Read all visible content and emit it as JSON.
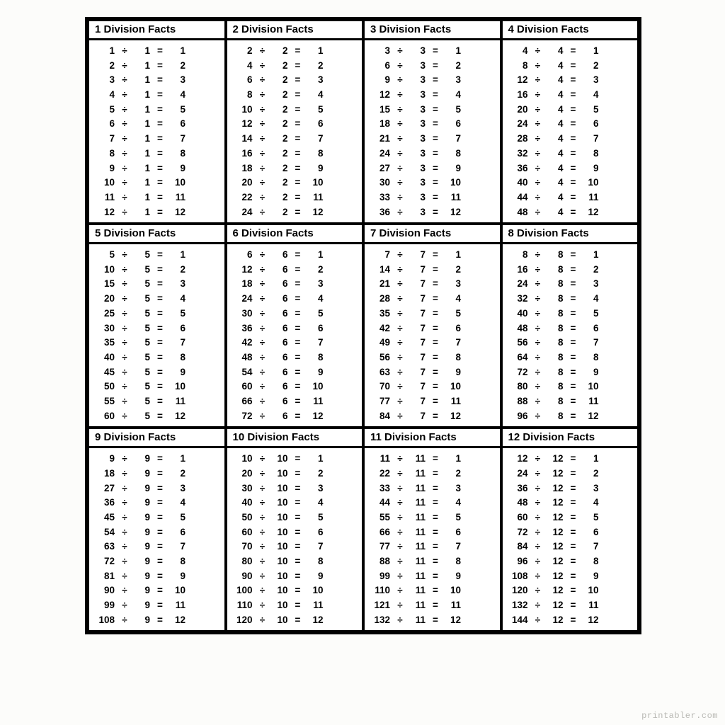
{
  "watermark": "printabler.com",
  "symbols": {
    "div": "÷",
    "eq": "="
  },
  "tables": [
    {
      "title": "1 Division Facts",
      "divisor": 1,
      "rows": [
        [
          1,
          1,
          1
        ],
        [
          2,
          1,
          2
        ],
        [
          3,
          1,
          3
        ],
        [
          4,
          1,
          4
        ],
        [
          5,
          1,
          5
        ],
        [
          6,
          1,
          6
        ],
        [
          7,
          1,
          7
        ],
        [
          8,
          1,
          8
        ],
        [
          9,
          1,
          9
        ],
        [
          10,
          1,
          10
        ],
        [
          11,
          1,
          11
        ],
        [
          12,
          1,
          12
        ]
      ]
    },
    {
      "title": "2 Division Facts",
      "divisor": 2,
      "rows": [
        [
          2,
          2,
          1
        ],
        [
          4,
          2,
          2
        ],
        [
          6,
          2,
          3
        ],
        [
          8,
          2,
          4
        ],
        [
          10,
          2,
          5
        ],
        [
          12,
          2,
          6
        ],
        [
          14,
          2,
          7
        ],
        [
          16,
          2,
          8
        ],
        [
          18,
          2,
          9
        ],
        [
          20,
          2,
          10
        ],
        [
          22,
          2,
          11
        ],
        [
          24,
          2,
          12
        ]
      ]
    },
    {
      "title": "3 Division Facts",
      "divisor": 3,
      "rows": [
        [
          3,
          3,
          1
        ],
        [
          6,
          3,
          2
        ],
        [
          9,
          3,
          3
        ],
        [
          12,
          3,
          4
        ],
        [
          15,
          3,
          5
        ],
        [
          18,
          3,
          6
        ],
        [
          21,
          3,
          7
        ],
        [
          24,
          3,
          8
        ],
        [
          27,
          3,
          9
        ],
        [
          30,
          3,
          10
        ],
        [
          33,
          3,
          11
        ],
        [
          36,
          3,
          12
        ]
      ]
    },
    {
      "title": "4 Division Facts",
      "divisor": 4,
      "rows": [
        [
          4,
          4,
          1
        ],
        [
          8,
          4,
          2
        ],
        [
          12,
          4,
          3
        ],
        [
          16,
          4,
          4
        ],
        [
          20,
          4,
          5
        ],
        [
          24,
          4,
          6
        ],
        [
          28,
          4,
          7
        ],
        [
          32,
          4,
          8
        ],
        [
          36,
          4,
          9
        ],
        [
          40,
          4,
          10
        ],
        [
          44,
          4,
          11
        ],
        [
          48,
          4,
          12
        ]
      ]
    },
    {
      "title": "5 Division Facts",
      "divisor": 5,
      "rows": [
        [
          5,
          5,
          1
        ],
        [
          10,
          5,
          2
        ],
        [
          15,
          5,
          3
        ],
        [
          20,
          5,
          4
        ],
        [
          25,
          5,
          5
        ],
        [
          30,
          5,
          6
        ],
        [
          35,
          5,
          7
        ],
        [
          40,
          5,
          8
        ],
        [
          45,
          5,
          9
        ],
        [
          50,
          5,
          10
        ],
        [
          55,
          5,
          11
        ],
        [
          60,
          5,
          12
        ]
      ]
    },
    {
      "title": "6 Division Facts",
      "divisor": 6,
      "rows": [
        [
          6,
          6,
          1
        ],
        [
          12,
          6,
          2
        ],
        [
          18,
          6,
          3
        ],
        [
          24,
          6,
          4
        ],
        [
          30,
          6,
          5
        ],
        [
          36,
          6,
          6
        ],
        [
          42,
          6,
          7
        ],
        [
          48,
          6,
          8
        ],
        [
          54,
          6,
          9
        ],
        [
          60,
          6,
          10
        ],
        [
          66,
          6,
          11
        ],
        [
          72,
          6,
          12
        ]
      ]
    },
    {
      "title": "7 Division Facts",
      "divisor": 7,
      "rows": [
        [
          7,
          7,
          1
        ],
        [
          14,
          7,
          2
        ],
        [
          21,
          7,
          3
        ],
        [
          28,
          7,
          4
        ],
        [
          35,
          7,
          5
        ],
        [
          42,
          7,
          6
        ],
        [
          49,
          7,
          7
        ],
        [
          56,
          7,
          8
        ],
        [
          63,
          7,
          9
        ],
        [
          70,
          7,
          10
        ],
        [
          77,
          7,
          11
        ],
        [
          84,
          7,
          12
        ]
      ]
    },
    {
      "title": "8 Division Facts",
      "divisor": 8,
      "rows": [
        [
          8,
          8,
          1
        ],
        [
          16,
          8,
          2
        ],
        [
          24,
          8,
          3
        ],
        [
          32,
          8,
          4
        ],
        [
          40,
          8,
          5
        ],
        [
          48,
          8,
          6
        ],
        [
          56,
          8,
          7
        ],
        [
          64,
          8,
          8
        ],
        [
          72,
          8,
          9
        ],
        [
          80,
          8,
          10
        ],
        [
          88,
          8,
          11
        ],
        [
          96,
          8,
          12
        ]
      ]
    },
    {
      "title": "9 Division Facts",
      "divisor": 9,
      "rows": [
        [
          9,
          9,
          1
        ],
        [
          18,
          9,
          2
        ],
        [
          27,
          9,
          3
        ],
        [
          36,
          9,
          4
        ],
        [
          45,
          9,
          5
        ],
        [
          54,
          9,
          6
        ],
        [
          63,
          9,
          7
        ],
        [
          72,
          9,
          8
        ],
        [
          81,
          9,
          9
        ],
        [
          90,
          9,
          10
        ],
        [
          99,
          9,
          11
        ],
        [
          108,
          9,
          12
        ]
      ]
    },
    {
      "title": "10 Division Facts",
      "divisor": 10,
      "rows": [
        [
          10,
          10,
          1
        ],
        [
          20,
          10,
          2
        ],
        [
          30,
          10,
          3
        ],
        [
          40,
          10,
          4
        ],
        [
          50,
          10,
          5
        ],
        [
          60,
          10,
          6
        ],
        [
          70,
          10,
          7
        ],
        [
          80,
          10,
          8
        ],
        [
          90,
          10,
          9
        ],
        [
          100,
          10,
          10
        ],
        [
          110,
          10,
          11
        ],
        [
          120,
          10,
          12
        ]
      ]
    },
    {
      "title": "11 Division Facts",
      "divisor": 11,
      "rows": [
        [
          11,
          11,
          1
        ],
        [
          22,
          11,
          2
        ],
        [
          33,
          11,
          3
        ],
        [
          44,
          11,
          4
        ],
        [
          55,
          11,
          5
        ],
        [
          66,
          11,
          6
        ],
        [
          77,
          11,
          7
        ],
        [
          88,
          11,
          8
        ],
        [
          99,
          11,
          9
        ],
        [
          110,
          11,
          10
        ],
        [
          121,
          11,
          11
        ],
        [
          132,
          11,
          12
        ]
      ]
    },
    {
      "title": "12 Division Facts",
      "divisor": 12,
      "rows": [
        [
          12,
          12,
          1
        ],
        [
          24,
          12,
          2
        ],
        [
          36,
          12,
          3
        ],
        [
          48,
          12,
          4
        ],
        [
          60,
          12,
          5
        ],
        [
          72,
          12,
          6
        ],
        [
          84,
          12,
          7
        ],
        [
          96,
          12,
          8
        ],
        [
          108,
          12,
          9
        ],
        [
          120,
          12,
          10
        ],
        [
          132,
          12,
          11
        ],
        [
          144,
          12,
          12
        ]
      ]
    }
  ]
}
